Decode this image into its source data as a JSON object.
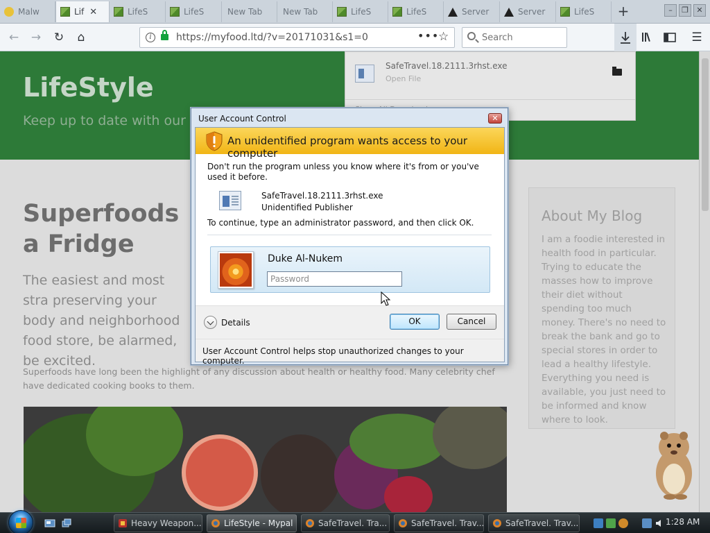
{
  "browser": {
    "tabs": [
      {
        "label": "Malw",
        "icon": "warning-icon"
      },
      {
        "label": "Lif",
        "icon": "image-icon",
        "active": true
      },
      {
        "label": "LifeS",
        "icon": "image-icon"
      },
      {
        "label": "LifeS",
        "icon": "image-icon"
      },
      {
        "label": "New Tab",
        "icon": ""
      },
      {
        "label": "New Tab",
        "icon": ""
      },
      {
        "label": "LifeS",
        "icon": "image-icon"
      },
      {
        "label": "LifeS",
        "icon": "image-icon"
      },
      {
        "label": "Server",
        "icon": "warning-icon"
      },
      {
        "label": "Server",
        "icon": "warning-icon"
      },
      {
        "label": "LifeS",
        "icon": "image-icon"
      }
    ],
    "url": "https://myfood.ltd/?v=20171031&s1=0",
    "search_placeholder": "Search"
  },
  "downloads_panel": {
    "file_name": "SafeTravel.18.2111.3rhst.exe",
    "file_action": "Open File",
    "show_all": "Show All Downloads"
  },
  "page": {
    "site_title": "LifeStyle",
    "site_tagline": "Keep up to date with our la",
    "article_title": "Superfoods a Fridge",
    "article_lead": "The easiest and most stra preserving your body and neighborhood food store, be alarmed, be excited.",
    "article_body": "Superfoods have long been the highlight of any discussion about health or healthy food. Many celebrity chef have dedicated cooking books to them.",
    "aside_heading": "About My Blog",
    "aside_body": "I am a foodie interested in health food in particular. Trying to educate the masses how to improve their diet without spending too much money. There's no need to break the bank and go to special stores in order to lead a healthy lifestyle. Everything you need is available, you just need to be informed and know where to look."
  },
  "uac": {
    "caption": "User Account Control",
    "banner": "An unidentified program wants access to your computer",
    "warning": "Don't run the program unless you know where it's from or you've used it before.",
    "program_name": "SafeTravel.18.2111.3rhst.exe",
    "publisher": "Unidentified Publisher",
    "instruction": "To continue, type an administrator password, and then click OK.",
    "user_name": "Duke Al-Nukem",
    "password_placeholder": "Password",
    "details_label": "Details",
    "ok_label": "OK",
    "cancel_label": "Cancel",
    "footer": "User Account Control helps stop unauthorized changes to your computer."
  },
  "taskbar": {
    "buttons": [
      {
        "label": "Heavy Weapon...",
        "icon": "game-icon"
      },
      {
        "label": "LifeStyle - Mypal",
        "icon": "browser-icon",
        "active": true
      },
      {
        "label": "SafeTravel. Tra...",
        "icon": "browser-icon"
      },
      {
        "label": "SafeTravel. Trav...",
        "icon": "browser-icon"
      },
      {
        "label": "SafeTravel. Trav...",
        "icon": "browser-icon"
      }
    ],
    "clock": "1:28 AM"
  },
  "colors": {
    "hero_green": "#2d7a38",
    "uac_banner": "#f1b515",
    "lock_green": "#12a23c"
  }
}
